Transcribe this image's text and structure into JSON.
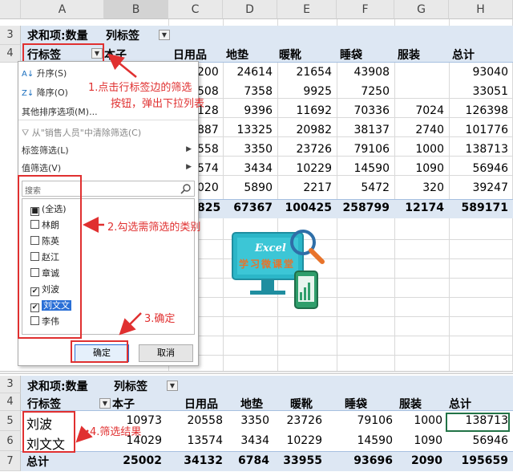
{
  "columns": [
    "A",
    "B",
    "C",
    "D",
    "E",
    "F",
    "G",
    "H"
  ],
  "top_pivot": {
    "row3": {
      "row_num": "3",
      "sum_label": "求和项:数量",
      "col_label": "列标签"
    },
    "row4": {
      "row_num": "4",
      "row_label": "行标签",
      "headers": [
        "本子",
        "日用品",
        "地垫",
        "暖靴",
        "睡袋",
        "服装",
        "总计"
      ]
    },
    "data_rows": [
      [
        "200",
        "24614",
        "21654",
        "43908",
        "",
        "93040"
      ],
      [
        "508",
        "7358",
        "9925",
        "7250",
        "",
        "33051"
      ],
      [
        "128",
        "9396",
        "11692",
        "70336",
        "7024",
        "126398"
      ],
      [
        "887",
        "13325",
        "20982",
        "38137",
        "2740",
        "101776"
      ],
      [
        "558",
        "3350",
        "23726",
        "79106",
        "1000",
        "138713"
      ],
      [
        "574",
        "3434",
        "10229",
        "14590",
        "1090",
        "56946"
      ],
      [
        "020",
        "5890",
        "2217",
        "5472",
        "320",
        "39247"
      ]
    ],
    "total_row": [
      "825",
      "67367",
      "100425",
      "258799",
      "12174",
      "589171"
    ]
  },
  "menu": {
    "sort_asc": "升序(S)",
    "sort_desc": "降序(O)",
    "more_sort": "其他排序选项(M)...",
    "clear_filter": "从\"销售人员\"中清除筛选(C)",
    "label_filter": "标签筛选(L)",
    "value_filter": "值筛选(V)",
    "search_placeholder": "搜索",
    "items": [
      {
        "label": "(全选)",
        "state": "■"
      },
      {
        "label": "林朗",
        "state": ""
      },
      {
        "label": "陈英",
        "state": ""
      },
      {
        "label": "赵江",
        "state": ""
      },
      {
        "label": "章诚",
        "state": ""
      },
      {
        "label": "刘波",
        "state": "✔"
      },
      {
        "label": "刘文文",
        "state": "✔"
      },
      {
        "label": "李伟",
        "state": ""
      }
    ],
    "ok": "确定",
    "cancel": "取消"
  },
  "annotations": {
    "step1_line1": "1.点击行标签边的筛选",
    "step1_line2": "按钮，弹出下拉列表",
    "step2": "2.勾选需筛选的类别",
    "step3": "3.确定",
    "step4": "4.筛选结果"
  },
  "logo": {
    "title": "Excel",
    "subtitle": "学习微课堂"
  },
  "bottom_pivot": {
    "row3": {
      "row_num": "3",
      "sum_label": "求和项:数量",
      "col_label": "列标签"
    },
    "row4": {
      "row_num": "4",
      "row_label": "行标签",
      "headers": [
        "本子",
        "日用品",
        "地垫",
        "暖靴",
        "睡袋",
        "服装",
        "总计"
      ]
    },
    "rows": [
      {
        "row_num": "5",
        "name": "刘波",
        "values": [
          "10973",
          "20558",
          "3350",
          "23726",
          "79106",
          "1000",
          "138713"
        ]
      },
      {
        "row_num": "6",
        "name": "刘文文",
        "values": [
          "14029",
          "13574",
          "3434",
          "10229",
          "14590",
          "1090",
          "56946"
        ]
      }
    ],
    "total": {
      "row_num": "7",
      "name": "总计",
      "values": [
        "25002",
        "34132",
        "6784",
        "33955",
        "93696",
        "2090",
        "195659"
      ]
    }
  },
  "colors": {
    "accent_red": "#e03030",
    "band": "#dde7f3",
    "cyan": "#2bb6c8"
  }
}
